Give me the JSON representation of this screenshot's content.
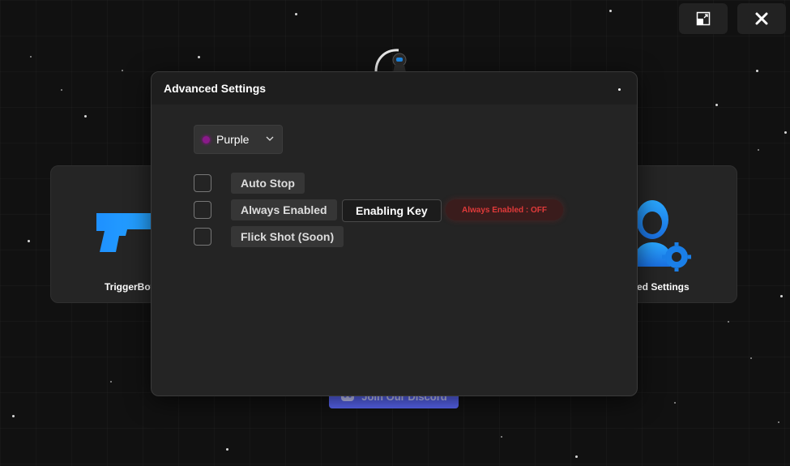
{
  "window_controls": {
    "restore_icon": "restore-window-icon",
    "close_icon": "close-icon"
  },
  "cards": {
    "triggerbot_label": "TriggerBot",
    "advanced_label": "nced Settings",
    "triggerbot_icon": "pistol-icon",
    "advanced_icon": "user-settings-icon"
  },
  "discord": {
    "label": "Join Our Discord",
    "icon": "discord-icon"
  },
  "modal": {
    "title": "Advanced Settings",
    "color_select": {
      "value": "Purple",
      "dot_color": "#8a1a8a"
    },
    "options": [
      {
        "label": "Auto Stop"
      },
      {
        "label": "Always Enabled"
      },
      {
        "label": "Flick Shot (Soon)"
      }
    ],
    "enabling_key_label": "Enabling Key",
    "status_text": "Always Enabled : OFF"
  },
  "colors": {
    "background": "#111111",
    "card": "#252525",
    "modal": "#242424",
    "accent_blue": "#1e88e5",
    "discord": "#5865f2",
    "status_red": "#e03a3a"
  }
}
